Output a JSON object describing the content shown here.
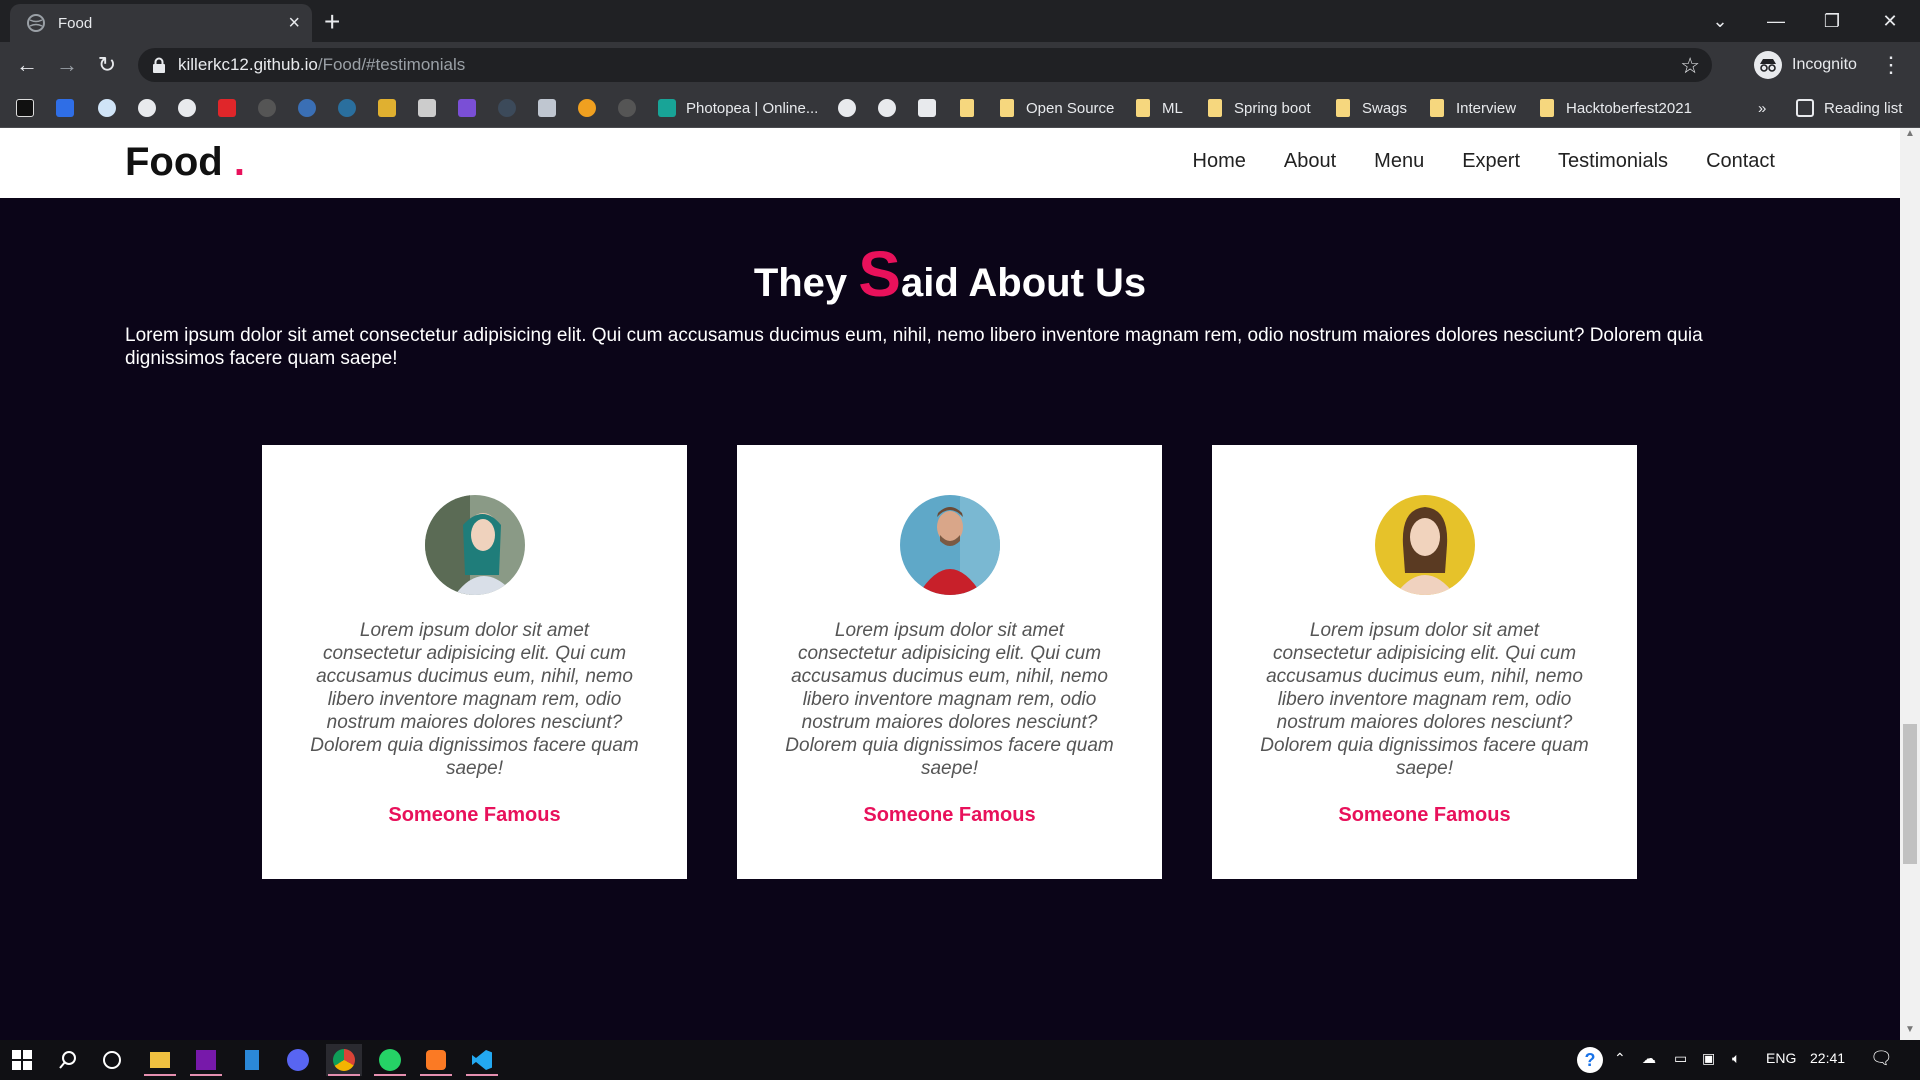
{
  "browser": {
    "tab_title": "Food",
    "tab_close": "×",
    "new_tab": "+",
    "url_host": "killerkc12.github.io",
    "url_path": "/Food/#testimonials",
    "profile_label": "Incognito",
    "reading_list": "Reading list",
    "overflow": "»",
    "bookmarks": [
      {
        "label": "Photopea | Online..."
      },
      {
        "label": "Open Source"
      },
      {
        "label": "ML"
      },
      {
        "label": "Spring boot"
      },
      {
        "label": "Swags"
      },
      {
        "label": "Interview"
      },
      {
        "label": "Hacktoberfest2021"
      }
    ]
  },
  "site": {
    "logo": "Food",
    "logo_dot": ".",
    "nav": [
      "Home",
      "About",
      "Menu",
      "Expert",
      "Testimonials",
      "Contact"
    ],
    "title_pre": "They ",
    "title_s": "S",
    "title_post": "aid About Us",
    "description": "Lorem ipsum dolor sit amet consectetur adipisicing elit. Qui cum accusamus ducimus eum, nihil, nemo libero inventore magnam rem, odio nostrum maiores dolores nesciunt? Dolorem quia dignissimos facere quam saepe!",
    "testimonials": [
      {
        "quote": "Lorem ipsum dolor sit amet consectetur adipisicing elit. Qui cum accusamus ducimus eum, nihil, nemo libero inventore magnam rem, odio nostrum maiores dolores nesciunt? Dolorem quia dignissimos facere quam saepe!",
        "name": "Someone Famous"
      },
      {
        "quote": "Lorem ipsum dolor sit amet consectetur adipisicing elit. Qui cum accusamus ducimus eum, nihil, nemo libero inventore magnam rem, odio nostrum maiores dolores nesciunt? Dolorem quia dignissimos facere quam saepe!",
        "name": "Someone Famous"
      },
      {
        "quote": "Lorem ipsum dolor sit amet consectetur adipisicing elit. Qui cum accusamus ducimus eum, nihil, nemo libero inventore magnam rem, odio nostrum maiores dolores nesciunt? Dolorem quia dignissimos facere quam saepe!",
        "name": "Someone Famous"
      }
    ]
  },
  "taskbar": {
    "language": "ENG",
    "time": "22:41"
  },
  "colors": {
    "accent": "#e8115b",
    "page_bg": "#0b0518"
  }
}
